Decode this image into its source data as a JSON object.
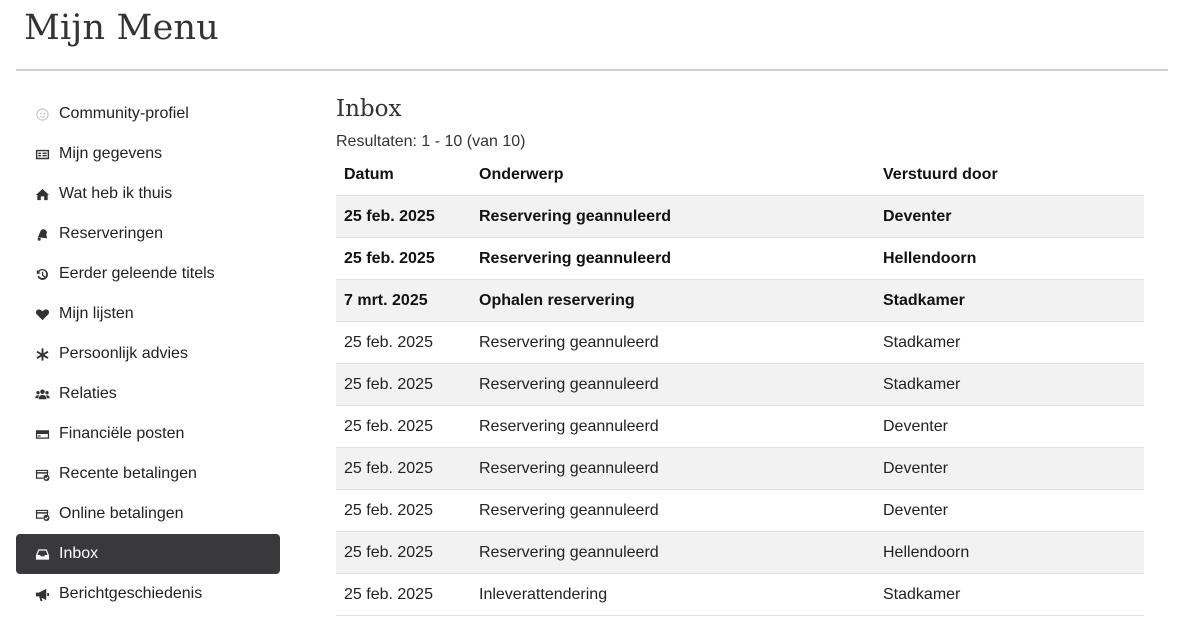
{
  "page_title": "Mijn Menu",
  "sidebar": {
    "items": [
      {
        "label": "Community-profiel",
        "icon": "smiley-icon",
        "active": false
      },
      {
        "label": "Mijn gegevens",
        "icon": "id-card-icon",
        "active": false
      },
      {
        "label": "Wat heb ik thuis",
        "icon": "home-icon",
        "active": false
      },
      {
        "label": "Reserveringen",
        "icon": "bell-icon",
        "active": false
      },
      {
        "label": "Eerder geleende titels",
        "icon": "history-icon",
        "active": false
      },
      {
        "label": "Mijn lijsten",
        "icon": "heart-icon",
        "active": false
      },
      {
        "label": "Persoonlijk advies",
        "icon": "asterisk-icon",
        "active": false
      },
      {
        "label": "Relaties",
        "icon": "users-icon",
        "active": false
      },
      {
        "label": "Financiële posten",
        "icon": "credit-card-icon",
        "active": false
      },
      {
        "label": "Recente betalingen",
        "icon": "card-check-icon",
        "active": false
      },
      {
        "label": "Online betalingen",
        "icon": "card-check-icon",
        "active": false
      },
      {
        "label": "Inbox",
        "icon": "inbox-icon",
        "active": true
      },
      {
        "label": "Berichtgeschiedenis",
        "icon": "megaphone-icon",
        "active": false
      }
    ]
  },
  "main": {
    "title": "Inbox",
    "results": "Resultaten: 1 - 10 (van 10)",
    "columns": [
      "Datum",
      "Onderwerp",
      "Verstuurd door"
    ],
    "rows": [
      {
        "date": "25 feb. 2025",
        "subject": "Reservering geannuleerd",
        "sender": "Deventer",
        "unread": true
      },
      {
        "date": "25 feb. 2025",
        "subject": "Reservering geannuleerd",
        "sender": "Hellendoorn",
        "unread": true
      },
      {
        "date": "7 mrt. 2025",
        "subject": "Ophalen reservering",
        "sender": "Stadkamer",
        "unread": true
      },
      {
        "date": "25 feb. 2025",
        "subject": "Reservering geannuleerd",
        "sender": "Stadkamer",
        "unread": false
      },
      {
        "date": "25 feb. 2025",
        "subject": "Reservering geannuleerd",
        "sender": "Stadkamer",
        "unread": false
      },
      {
        "date": "25 feb. 2025",
        "subject": "Reservering geannuleerd",
        "sender": "Deventer",
        "unread": false
      },
      {
        "date": "25 feb. 2025",
        "subject": "Reservering geannuleerd",
        "sender": "Deventer",
        "unread": false
      },
      {
        "date": "25 feb. 2025",
        "subject": "Reservering geannuleerd",
        "sender": "Deventer",
        "unread": false
      },
      {
        "date": "25 feb. 2025",
        "subject": "Reservering geannuleerd",
        "sender": "Hellendoorn",
        "unread": false
      },
      {
        "date": "25 feb. 2025",
        "subject": "Inleverattendering",
        "sender": "Stadkamer",
        "unread": false
      }
    ]
  },
  "colors": {
    "active_bg": "#39383a",
    "row_stripe": "#f2f2f2",
    "rule": "#cfcfcf"
  }
}
